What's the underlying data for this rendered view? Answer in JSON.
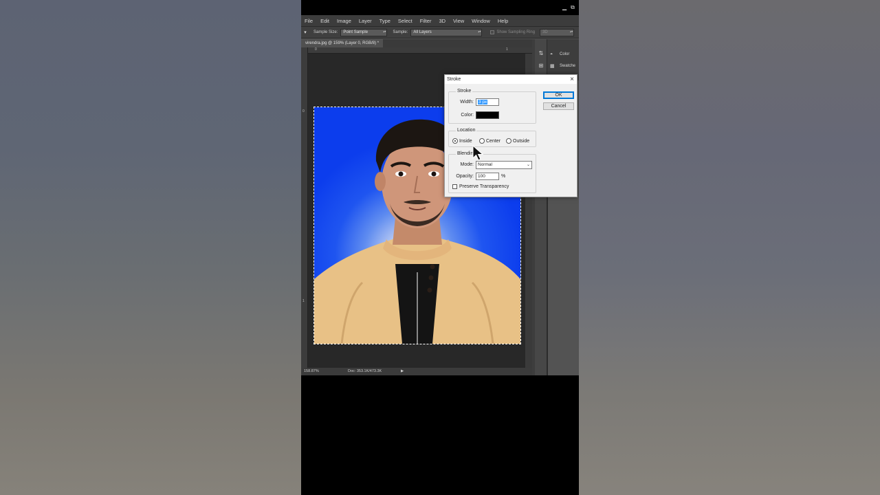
{
  "menu": [
    "File",
    "Edit",
    "Image",
    "Layer",
    "Type",
    "Select",
    "Filter",
    "3D",
    "View",
    "Window",
    "Help"
  ],
  "window_controls": [
    "▁",
    "⧉"
  ],
  "options_bar": {
    "tool_icon": "eyedropper-icon",
    "tool_glyph": "▾",
    "sample_size_label": "Sample Size:",
    "sample_size_value": "Point Sample",
    "sample_label": "Sample:",
    "sample_value": "All Layers",
    "show_ring_label": "Show Sampling Ring",
    "extra_value": "3D"
  },
  "document": {
    "tab_title": "virendra.jpg @ 159% (Layer 0, RGB/8) *",
    "ruler_h_marks": [
      "0",
      "1"
    ],
    "ruler_v_marks": [
      "0",
      "1"
    ],
    "status_zoom": "158.87%",
    "status_doc": "Doc: 353.1K/473.3K",
    "status_arrow": "▶"
  },
  "panels": {
    "color_label": "Color",
    "swatches_label": "Swatche",
    "dock_icons": [
      "⇅",
      "⊞"
    ],
    "color_icon_glyph": "◓",
    "swatches_icon_glyph": "▦"
  },
  "stroke_dialog": {
    "title": "Stroke",
    "close_glyph": "×",
    "stroke_group": "Stroke",
    "width_label": "Width:",
    "width_value": "3 px",
    "color_label": "Color:",
    "color_value": "#000000",
    "location_group": "Location",
    "location_options": [
      "Inside",
      "Center",
      "Outside"
    ],
    "location_selected": "Inside",
    "blending_group": "Blending",
    "mode_label": "Mode:",
    "mode_value": "Normal",
    "opacity_label": "Opacity:",
    "opacity_value": "100",
    "opacity_unit": "%",
    "preserve_label": "Preserve Transparency",
    "preserve_checked": false,
    "ok_label": "OK",
    "cancel_label": "Cancel"
  }
}
